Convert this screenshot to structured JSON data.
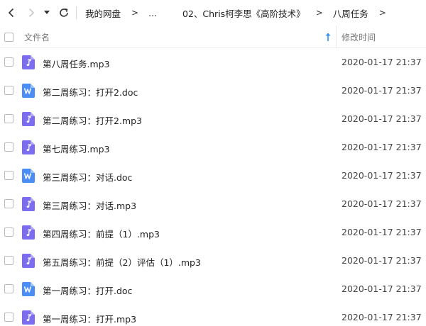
{
  "nav": {
    "back_icon": "chevron-left-icon",
    "forward_icon": "chevron-right-icon",
    "history_icon": "caret-down-icon",
    "refresh_icon": "refresh-icon"
  },
  "breadcrumb": {
    "items": [
      "我的网盘",
      "...",
      "02、Chris柯李思《高阶技术》",
      "八周任务"
    ],
    "separator": ">"
  },
  "header": {
    "name_label": "文件名",
    "date_label": "修改时间",
    "sort_icon": "sort-ascending-arrow-icon"
  },
  "files": [
    {
      "name": "第八周任务.mp3",
      "type": "audio",
      "modified": "2020-01-17 21:37"
    },
    {
      "name": "第二周练习：打开2.doc",
      "type": "word",
      "modified": "2020-01-17 21:37"
    },
    {
      "name": "第二周练习：打开2.mp3",
      "type": "audio",
      "modified": "2020-01-17 21:37"
    },
    {
      "name": "第七周练习.mp3",
      "type": "audio",
      "modified": "2020-01-17 21:37"
    },
    {
      "name": "第三周练习：对话.doc",
      "type": "word",
      "modified": "2020-01-17 21:37"
    },
    {
      "name": "第三周练习：对话.mp3",
      "type": "audio",
      "modified": "2020-01-17 21:37"
    },
    {
      "name": "第四周练习：前提（1）.mp3",
      "type": "audio",
      "modified": "2020-01-17 21:37"
    },
    {
      "name": "第五周练习：前提（2）评估（1）.mp3",
      "type": "audio",
      "modified": "2020-01-17 21:37"
    },
    {
      "name": "第一周练习：打开.doc",
      "type": "word",
      "modified": "2020-01-17 21:37"
    },
    {
      "name": "第一周练习：打开.mp3",
      "type": "audio",
      "modified": "2020-01-17 21:37"
    }
  ],
  "colors": {
    "audio_icon": "#7b6cf0",
    "word_icon": "#4a8ef5",
    "sort_arrow": "#2f8ef5"
  }
}
